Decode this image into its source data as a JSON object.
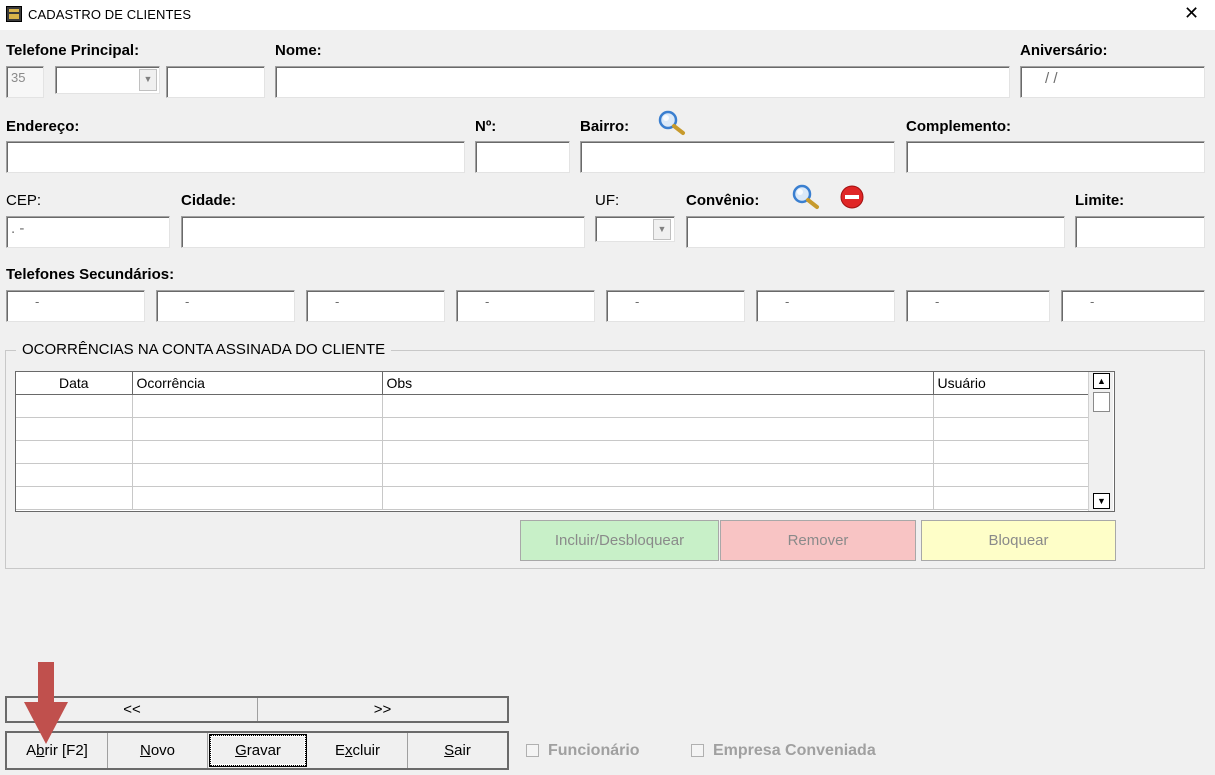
{
  "window": {
    "title": "CADASTRO DE CLIENTES",
    "close_glyph": "✕",
    "app_icon": "register-icon"
  },
  "labels": {
    "telefone_principal": "Telefone Principal:",
    "nome": "Nome:",
    "aniversario": "Aniversário:",
    "endereco": "Endereço:",
    "numero": "Nº:",
    "bairro": "Bairro:",
    "complemento": "Complemento:",
    "cep": "CEP:",
    "cidade": "Cidade:",
    "uf": "UF:",
    "convenio": "Convênio:",
    "limite": "Limite:",
    "telefones_secundarios": "Telefones Secundários:"
  },
  "fields": {
    "ddd": "35",
    "aniversario_mask": "/ /",
    "cep_mask": ". -",
    "phone_mask": "-",
    "combo_arrow": "▼"
  },
  "ocorrencias": {
    "title": "OCORRÊNCIAS NA CONTA ASSINADA DO CLIENTE",
    "columns": [
      "Data",
      "Ocorrência",
      "Obs",
      "Usuário"
    ],
    "scroll_up": "▲",
    "scroll_down": "▼",
    "buttons": {
      "incluir": "Incluir/Desbloquear",
      "remover": "Remover",
      "bloquear": "Bloquear"
    },
    "colors": {
      "incluir": "#c8f0c8",
      "remover": "#f8c4c4",
      "bloquear": "#fefec8"
    }
  },
  "navigation": {
    "prev": "<<",
    "next": ">>"
  },
  "toolbar": {
    "abrir": {
      "before": "A",
      "accel": "b",
      "after": "rir [F2]"
    },
    "novo": {
      "before": "",
      "accel": "N",
      "after": "ovo"
    },
    "gravar": {
      "before": "",
      "accel": "G",
      "after": "ravar"
    },
    "excluir": {
      "before": "E",
      "accel": "x",
      "after": "cluir"
    },
    "sair": {
      "before": "",
      "accel": "S",
      "after": "air"
    }
  },
  "checkboxes": {
    "funcionario": "Funcionário",
    "empresa_conveniada": "Empresa Conveniada"
  },
  "colors": {
    "annotation_arrow": "#c0504d",
    "search_icon": "#3a7fd0",
    "remove_icon": "#d92020"
  }
}
